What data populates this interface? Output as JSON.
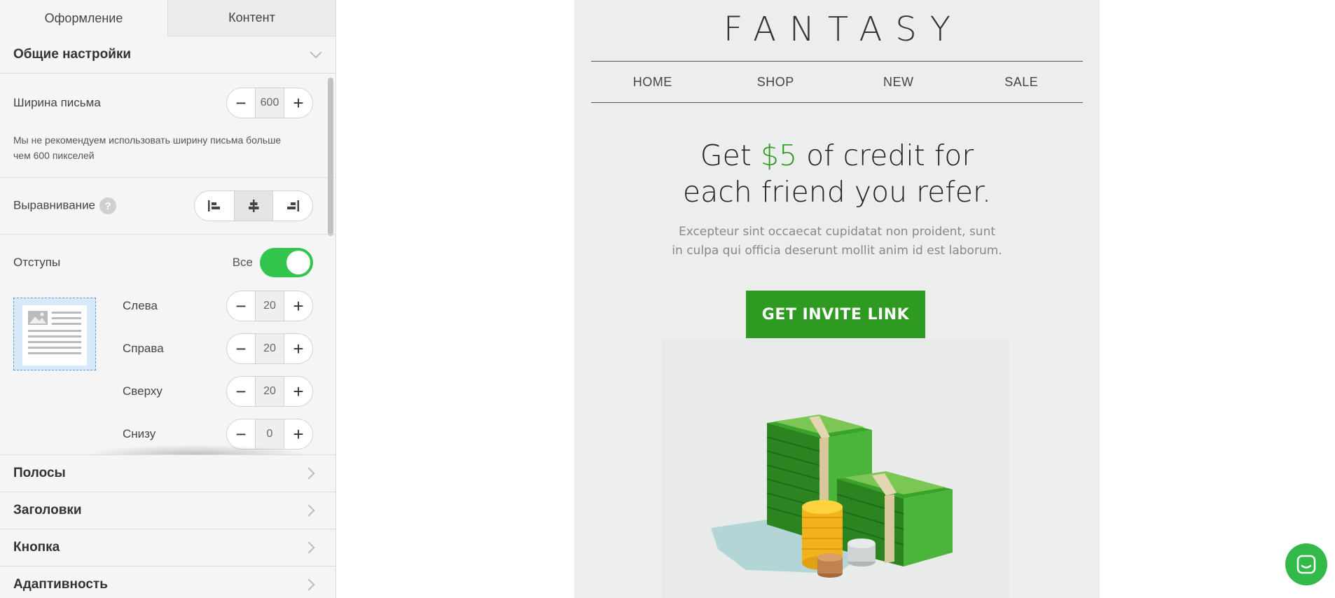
{
  "tabs": [
    {
      "label": "Оформление"
    },
    {
      "label": "Контент"
    }
  ],
  "general": {
    "title": "Общие настройки",
    "width_label": "Ширина письма",
    "width_value": "600",
    "width_hint_line1": "Мы не рекомендуем использовать ширину письма больше",
    "width_hint_line2": "чем 600 пикселей",
    "align_label": "Выравнивание",
    "align_help": "?",
    "align_selected": "center",
    "padding_label": "Отступы",
    "padding_all_label": "Все",
    "padding_all_enabled": true,
    "padding": {
      "left_label": "Слева",
      "left_value": "20",
      "right_label": "Справа",
      "right_value": "20",
      "top_label": "Сверху",
      "top_value": "20",
      "bottom_label": "Снизу",
      "bottom_value": "0"
    },
    "minus": "−",
    "plus": "+"
  },
  "accordion": [
    {
      "label": "Полосы"
    },
    {
      "label": "Заголовки"
    },
    {
      "label": "Кнопка"
    },
    {
      "label": "Адаптивность"
    }
  ],
  "preview": {
    "logo": "FANTASY",
    "nav": [
      "HOME",
      "SHOP",
      "NEW",
      "SALE"
    ],
    "headline_pre": "Get ",
    "headline_accent": "$5",
    "headline_post": " of credit for",
    "headline_line2": "each friend you refer.",
    "body_line1": "Excepteur sint occaecat cupidatat non proident, sunt",
    "body_line2": "in culpa qui officia deserunt mollit anim id est laborum.",
    "cta": "GET INVITE LINK"
  },
  "colors": {
    "accent_green": "#2f9a22",
    "toggle_green": "#33c44d",
    "chat_green": "#33b84a",
    "preview_bg": "#eceded"
  },
  "icons": {
    "collapse": "chevron-down-icon",
    "expand": "chevron-right-icon",
    "align_left": "align-left-icon",
    "align_center": "align-center-icon",
    "align_right": "align-right-icon",
    "chat": "chat-icon"
  }
}
